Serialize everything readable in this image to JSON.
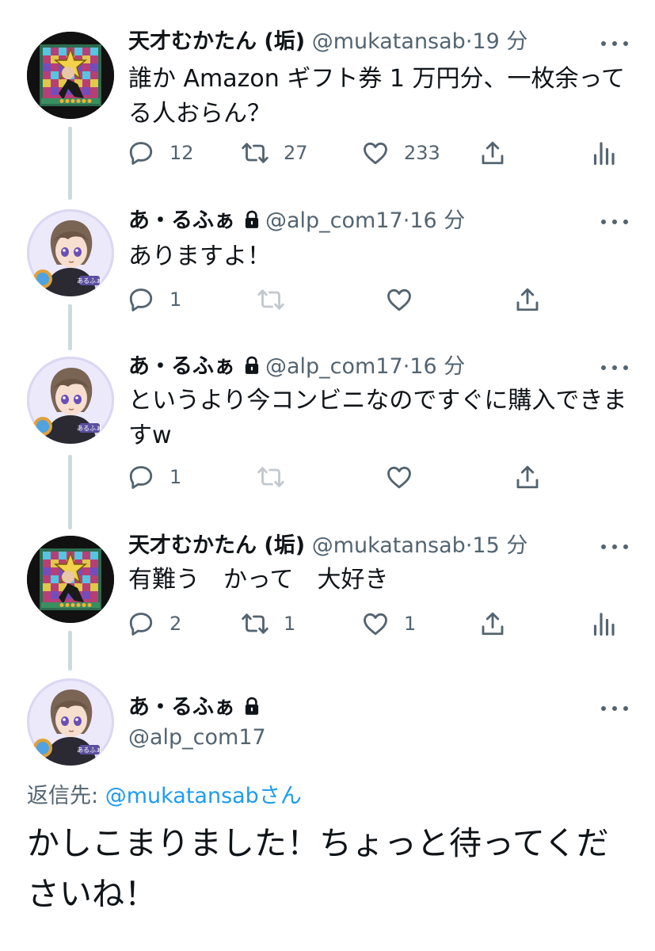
{
  "tweets": [
    {
      "name": "天才むかたん (垢)",
      "handle": "@mukatansab",
      "dot": "·",
      "time": "19 分",
      "text": "誰か Amazon ギフト券 1 万円分、一枚余ってる人おらん？",
      "reply_count": "12",
      "retweet_count": "27",
      "like_count": "233"
    },
    {
      "name": "あ・るふぁ",
      "handle": "@alp_com17",
      "dot": "·",
      "time": "16 分",
      "text": "ありますよ！",
      "reply_count": "1"
    },
    {
      "name": "あ・るふぁ",
      "handle": "@alp_com17",
      "dot": "·",
      "time": "16 分",
      "text": "というより今コンビニなのですぐに購入できますw",
      "reply_count": "1"
    },
    {
      "name": "天才むかたん (垢)",
      "handle": "@mukatansab",
      "dot": "·",
      "time": "15 分",
      "text": "有難う　かって　大好き",
      "reply_count": "2",
      "retweet_count": "1",
      "like_count": "1"
    }
  ],
  "focused": {
    "name": "あ・るふぁ",
    "handle": "@alp_com17",
    "reply_label": "返信先:",
    "reply_mention": "@mukatansab",
    "reply_suffix": "さん",
    "text": "かしこまりました！ちょっと待ってくださいね！"
  },
  "icons": [
    "reply-icon",
    "retweet-icon",
    "like-icon",
    "share-icon",
    "analytics-icon",
    "lock-icon",
    "more-icon",
    "avatar-image"
  ],
  "colors": {
    "text": "#0f1419",
    "muted": "#536471",
    "link": "#1d9bf0",
    "thread_line": "#cfd9de"
  }
}
